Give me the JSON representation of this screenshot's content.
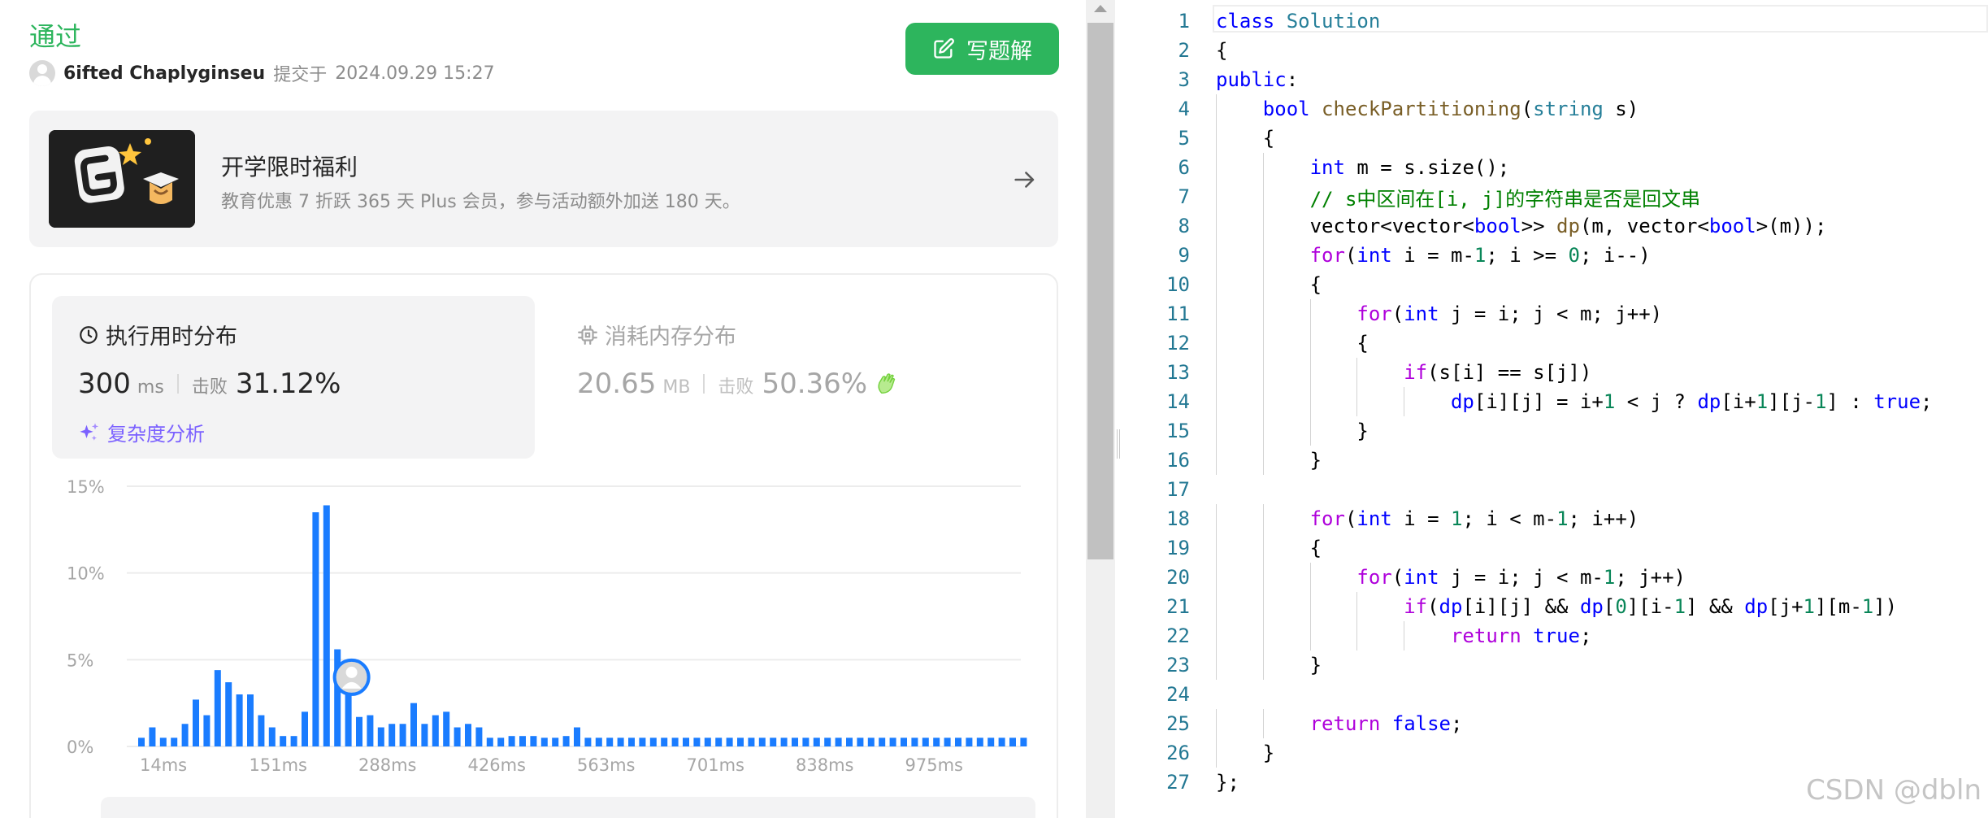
{
  "submission": {
    "status": "通过",
    "user_name": "6ifted Chaplyginseu",
    "submitted_label": "提交于",
    "submitted_time": "2024.09.29 15:27",
    "write_solution_label": "写题解"
  },
  "promo": {
    "title": "开学限时福利",
    "description": "教育优惠 7 折跃 365 天 Plus 会员，参与活动额外加送 180 天。"
  },
  "runtime": {
    "title": "执行用时分布",
    "value": "300",
    "unit": "ms",
    "beat_label": "击败",
    "beat_value": "31.12%",
    "complexity_label": "复杂度分析"
  },
  "memory": {
    "title": "消耗内存分布",
    "value": "20.65",
    "unit": "MB",
    "beat_label": "击败",
    "beat_value": "50.36%"
  },
  "chart_data": {
    "type": "bar",
    "y_ticks": [
      "15%",
      "10%",
      "5%",
      "0%"
    ],
    "ylim": [
      0,
      15
    ],
    "x_ticks": [
      "14ms",
      "151ms",
      "288ms",
      "426ms",
      "563ms",
      "701ms",
      "838ms",
      "975ms"
    ],
    "values": [
      0.5,
      1.1,
      0.5,
      0.5,
      1.3,
      2.7,
      1.8,
      4.4,
      3.7,
      3.0,
      3.0,
      1.8,
      1.1,
      0.6,
      0.6,
      2.0,
      13.5,
      13.9,
      5.6,
      3.8,
      1.7,
      1.8,
      1.1,
      1.3,
      1.3,
      2.5,
      1.3,
      1.8,
      2.0,
      1.1,
      1.3,
      1.1,
      0.5,
      0.5,
      0.6,
      0.6,
      0.6,
      0.5,
      0.5,
      0.6,
      1.1,
      0.5,
      0.5,
      0.5,
      0.5,
      0.5,
      0.5,
      0.5,
      0.5,
      0.5,
      0.5,
      0.5,
      0.5,
      0.5,
      0.5,
      0.5,
      0.5,
      0.5,
      0.5,
      0.5,
      0.5,
      0.5,
      0.5,
      0.5,
      0.5,
      0.5,
      0.5,
      0.5,
      0.5,
      0.5,
      0.5,
      0.5,
      0.5,
      0.5,
      0.5,
      0.5,
      0.5,
      0.5,
      0.5,
      0.5,
      0.5,
      0.5
    ],
    "highlight_index": 19,
    "bar_color": "#1a7cff",
    "grid": true
  },
  "code": {
    "lines": [
      "class Solution",
      "{",
      "public:",
      "    bool checkPartitioning(string s)",
      "    {",
      "        int m = s.size();",
      "        // s中区间在[i, j]的字符串是否是回文串",
      "        vector<vector<bool>> dp(m, vector<bool>(m));",
      "        for(int i = m-1; i >= 0; i--)",
      "        {",
      "            for(int j = i; j < m; j++)",
      "            {",
      "                if(s[i] == s[j])",
      "                    dp[i][j] = i+1 < j ? dp[i+1][j-1] : true;",
      "            }",
      "        }",
      "",
      "        for(int i = 1; i < m-1; i++)",
      "        {",
      "            for(int j = i; j < m-1; j++)",
      "                if(dp[i][j] && dp[0][i-1] && dp[j+1][m-1])",
      "                    return true;",
      "        }",
      "",
      "        return false;",
      "    }",
      "};"
    ]
  },
  "watermark": "CSDN @dbln"
}
